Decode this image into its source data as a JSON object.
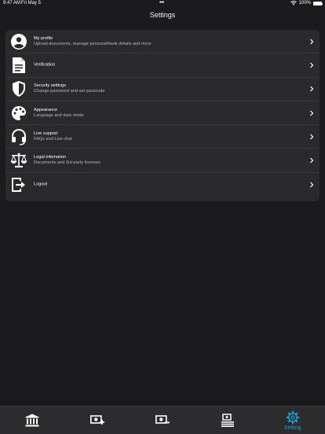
{
  "status_bar": {
    "time": "9:47 AM",
    "date": "Fri May 5",
    "battery": "100%"
  },
  "header": {
    "title": "Settings"
  },
  "settings": {
    "items": [
      {
        "title": "My profile",
        "subtitle": "Upload documents, manage personal/bank details and more",
        "icon": "person-icon"
      },
      {
        "title": "Verification",
        "subtitle": "",
        "icon": "document-icon"
      },
      {
        "title": "Security settings",
        "subtitle": "Change password and set passcode",
        "icon": "shield-icon"
      },
      {
        "title": "Appearance",
        "subtitle": "Language and dark mode",
        "icon": "palette-icon"
      },
      {
        "title": "Live support",
        "subtitle": "FAQs and Live chat",
        "icon": "headset-icon"
      },
      {
        "title": "Legal infomation",
        "subtitle": "Documents and 3rd-party licenses",
        "icon": "scales-icon"
      },
      {
        "title": "Logout",
        "subtitle": "",
        "icon": "logout-icon"
      }
    ]
  },
  "tab_bar": {
    "active_color": "#1f9bd1",
    "tabs": [
      {
        "icon": "bank-icon",
        "label": ""
      },
      {
        "icon": "deposit-icon",
        "label": ""
      },
      {
        "icon": "withdraw-icon",
        "label": ""
      },
      {
        "icon": "transfer-list-icon",
        "label": ""
      },
      {
        "icon": "gear-icon",
        "label": "Setting",
        "active": true
      }
    ]
  }
}
